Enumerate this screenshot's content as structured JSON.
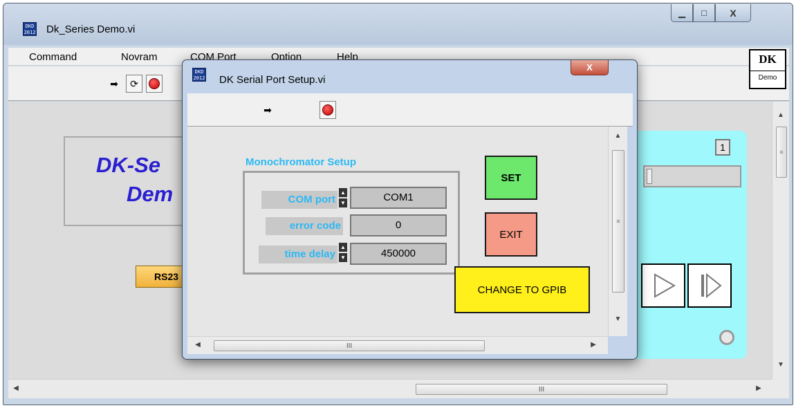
{
  "main_window": {
    "title": "Dk_Series Demo.vi",
    "icon_text": "DKD 2012",
    "controls": {
      "minimize": "▁",
      "maximize": "□",
      "close": "X"
    },
    "menu": [
      "Command",
      "Novram",
      "COM Port",
      "Option",
      "Help"
    ],
    "logo": {
      "big": "DK",
      "small": "Demo"
    },
    "panel": {
      "title_line1": "DK-Se",
      "title_line2": "Dem",
      "rs_button": "RS23",
      "digit_display": "1",
      "hscroll_grip": "III",
      "vscroll_grip": "≡"
    }
  },
  "dialog": {
    "title": "DK Serial Port Setup.vi",
    "icon_text": "DKD 2012",
    "close": "X",
    "setup_title": "Monochromator Setup",
    "fields": [
      {
        "label": "COM port",
        "value": "COM1"
      },
      {
        "label": "error code",
        "value": "0"
      },
      {
        "label": "time delay",
        "value": "450000"
      }
    ],
    "buttons": {
      "set": "SET",
      "exit": "EXIT",
      "gpib": "CHANGE TO GPIB"
    },
    "hscroll_grip": "III",
    "vscroll_grip": "≡"
  },
  "colors": {
    "accent_label": "#2bb9f4",
    "set_button": "#6de86d",
    "exit_button": "#f59a86",
    "gpib_button": "#fff01c",
    "cyan_panel": "#9ff8fc",
    "title_text": "#2a1fd1"
  },
  "icons": [
    "run-arrow-icon",
    "run-continuous-icon",
    "stop-icon",
    "play-icon",
    "step-icon",
    "busy-ring-icon"
  ]
}
